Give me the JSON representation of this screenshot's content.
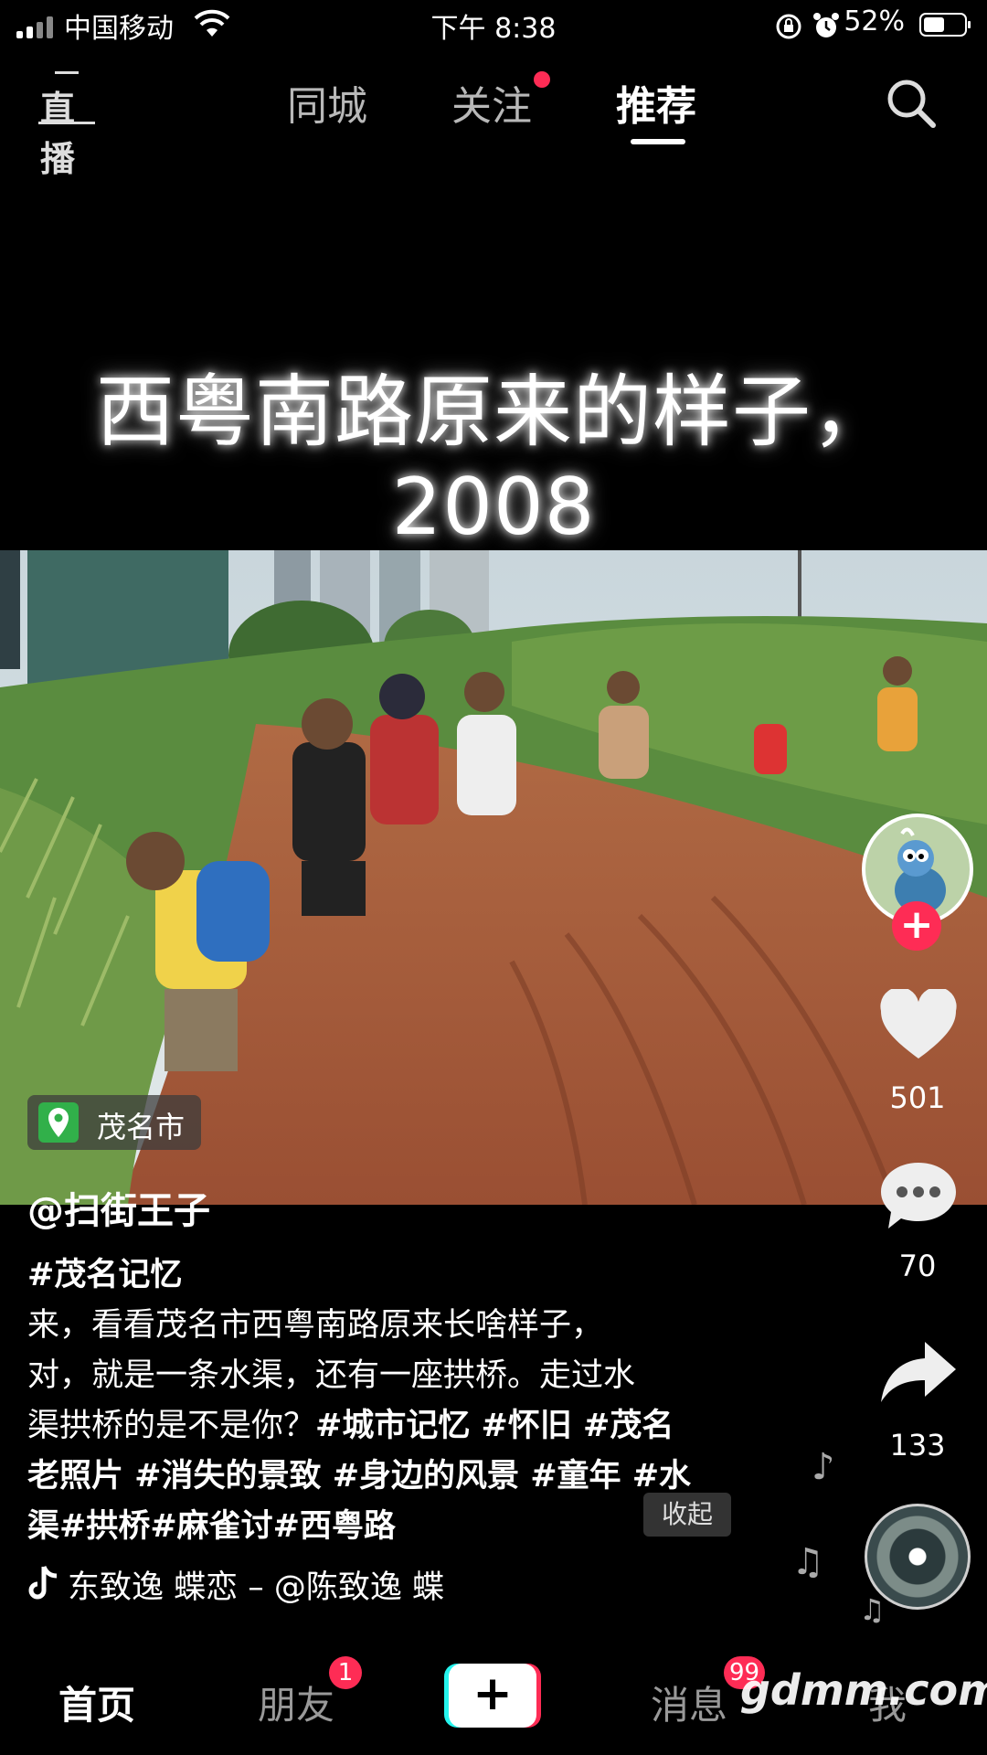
{
  "status_bar": {
    "carrier": "中国移动",
    "time": "下午 8:38",
    "battery": "52%"
  },
  "top_nav": {
    "live_label": "直播",
    "tabs": [
      {
        "label": "同城",
        "active": false
      },
      {
        "label": "关注",
        "active": false,
        "has_dot": true
      },
      {
        "label": "推荐",
        "active": true
      }
    ]
  },
  "video": {
    "caption": "西粤南路原来的样子，2008",
    "location": "茂名市",
    "author": "@扫街王子",
    "description_plain": "#茂名记忆",
    "description_line2": "来，看看茂名市西粤南路原来长啥样子，",
    "description_line3": "对，就是一条水渠，还有一座拱桥。走过水",
    "description_line4a": "渠拱桥的是不是你？",
    "description_line4b": "#城市记忆 #怀旧 #茂名",
    "description_line5": "老照片 #消失的景致 #身边的风景 #童年 #水",
    "description_line6": "渠#拱桥#麻雀讨#西粤路",
    "collapse_label": "收起",
    "music": "东致逸   蝶恋 – @陈致逸   蝶"
  },
  "rail": {
    "likes": "501",
    "comments": "70",
    "shares": "133"
  },
  "bottom_nav": {
    "home": "首页",
    "friends": "朋友",
    "friends_badge": "1",
    "messages": "消息",
    "messages_badge": "99",
    "me": "我"
  },
  "watermark": "gdmm.com",
  "colors": {
    "accent": "#fe2c55",
    "location_pin": "#31b04a"
  }
}
